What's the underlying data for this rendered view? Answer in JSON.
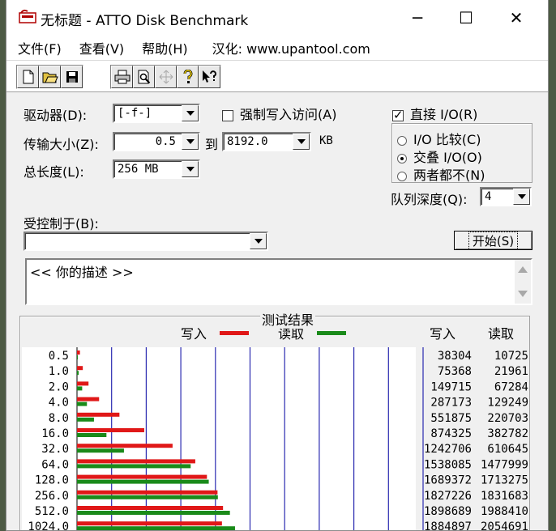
{
  "window": {
    "title": "无标题 - ATTO Disk Benchmark",
    "controls": {
      "minimize": "─",
      "maximize": "☐",
      "close": "✕"
    }
  },
  "menu": {
    "file": "文件(F)",
    "view": "查看(V)",
    "help": "帮助(H)",
    "hanhua": "汉化: www.upantool.com"
  },
  "toolbar": {
    "buttons": [
      "new-icon",
      "open-icon",
      "save-icon",
      "print-icon",
      "print-preview-icon",
      "move-icon",
      "help-icon",
      "context-help-icon"
    ]
  },
  "settings": {
    "drive_label": "驱动器(D):",
    "drive_value": "[-f-]",
    "force_write_label": "强制写入访问(A)",
    "force_write_checked": false,
    "direct_io_label": "直接 I/O(R)",
    "direct_io_checked": true,
    "transfer_label": "传输大小(Z):",
    "transfer_from": "0.5",
    "to_label": "到",
    "transfer_to": "8192.0",
    "kb_label": "KB",
    "total_label": "总长度(L):",
    "total_value": "256 MB",
    "io_compare": "I/O 比较(C)",
    "overlapped_io": "交叠 I/O(O)",
    "neither": "两者都不(N)",
    "selected_mode": "overlapped_io",
    "queue_label": "队列深度(Q):",
    "queue_value": "4",
    "controlled_label": "受控制于(B):",
    "controlled_value": "",
    "start_button": "开始(S)",
    "description": "<<  你的描述   >>"
  },
  "results": {
    "title": "测试结果",
    "legend_write": "写入",
    "legend_read": "读取",
    "col_write": "写入",
    "col_read": "读取"
  },
  "chart_data": {
    "type": "bar",
    "title": "测试结果",
    "orientation": "horizontal",
    "categories": [
      "0.5",
      "1.0",
      "2.0",
      "4.0",
      "8.0",
      "16.0",
      "32.0",
      "64.0",
      "128.0",
      "256.0",
      "512.0",
      "1024.0"
    ],
    "series": [
      {
        "name": "写入",
        "color": "#e01818",
        "values": [
          38304,
          75368,
          149715,
          287173,
          551875,
          874325,
          1242706,
          1538085,
          1689372,
          1827226,
          1898689,
          1884897
        ]
      },
      {
        "name": "读取",
        "color": "#1a8a1a",
        "values": [
          10725,
          21961,
          67284,
          129249,
          220703,
          382782,
          610645,
          1477999,
          1713275,
          1831683,
          1988410,
          2054691
        ]
      }
    ],
    "xlim": [
      0,
      4500000
    ],
    "grid": true
  }
}
